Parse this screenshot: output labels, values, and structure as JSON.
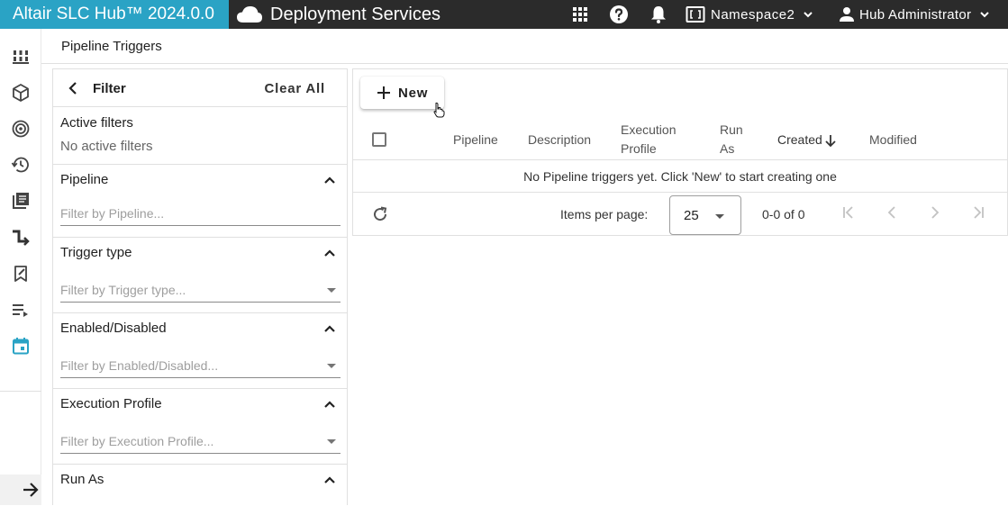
{
  "app": {
    "brand": "Altair SLC Hub™ 2024.0.0",
    "service": "Deployment Services",
    "namespace": "Namespace2",
    "user": "Hub Administrator"
  },
  "icons": {
    "apps": "apps-grid-icon",
    "help": "help-icon",
    "notifications": "bell-icon",
    "namespace": "namespace-icon",
    "user": "person-icon"
  },
  "colors": {
    "brand": "#2aa3c5",
    "topbar": "#2b2b2b",
    "active_nav": "#2aa3c5"
  },
  "page": {
    "title": "Pipeline Triggers"
  },
  "filter": {
    "title": "Filter",
    "clear_all": "Clear All",
    "active_heading": "Active filters",
    "active_value": "No active filters",
    "sections": [
      {
        "label": "Pipeline",
        "placeholder": "Filter by Pipeline...",
        "dropdown": false
      },
      {
        "label": "Trigger type",
        "placeholder": "Filter by Trigger type...",
        "dropdown": true
      },
      {
        "label": "Enabled/Disabled",
        "placeholder": "Filter by Enabled/Disabled...",
        "dropdown": true
      },
      {
        "label": "Execution Profile",
        "placeholder": "Filter by Execution Profile...",
        "dropdown": true
      },
      {
        "label": "Run As"
      }
    ]
  },
  "table": {
    "new_button": "New",
    "columns": [
      "Pipeline",
      "Description",
      "Execution",
      "Profile",
      "Run",
      "As",
      "Created",
      "Modified"
    ],
    "empty_message": "No Pipeline triggers yet. Click 'New' to start creating one",
    "items_per_page_label": "Items per page:",
    "items_per_page": "25",
    "range": "0-0 of 0"
  }
}
